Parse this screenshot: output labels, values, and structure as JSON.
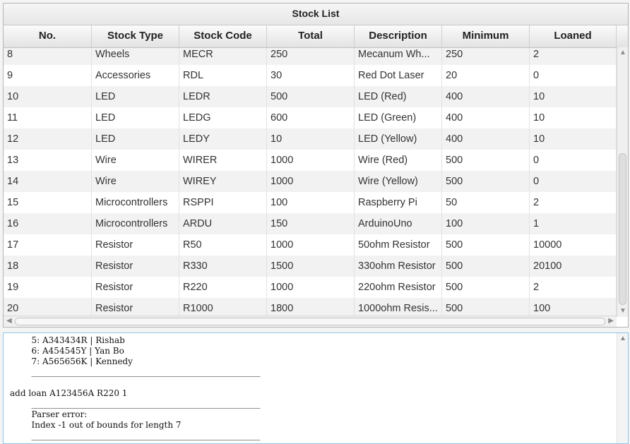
{
  "table": {
    "title": "Stock List",
    "columns": [
      "No.",
      "Stock Type",
      "Stock Code",
      "Total",
      "Description",
      "Minimum",
      "Loaned"
    ],
    "rows": [
      [
        "8",
        "Wheels",
        "MECR",
        "250",
        "Mecanum Wh...",
        "250",
        "2"
      ],
      [
        "9",
        "Accessories",
        "RDL",
        "30",
        "Red Dot Laser",
        "20",
        "0"
      ],
      [
        "10",
        "LED",
        "LEDR",
        "500",
        "LED (Red)",
        "400",
        "10"
      ],
      [
        "11",
        "LED",
        "LEDG",
        "600",
        "LED (Green)",
        "400",
        "10"
      ],
      [
        "12",
        "LED",
        "LEDY",
        "10",
        "LED (Yellow)",
        "400",
        "10"
      ],
      [
        "13",
        "Wire",
        "WIRER",
        "1000",
        "Wire (Red)",
        "500",
        "0"
      ],
      [
        "14",
        "Wire",
        "WIREY",
        "1000",
        "Wire (Yellow)",
        "500",
        "0"
      ],
      [
        "15",
        "Microcontrollers",
        "RSPPI",
        "100",
        "Raspberry Pi",
        "50",
        "2"
      ],
      [
        "16",
        "Microcontrollers",
        "ARDU",
        "150",
        "ArduinoUno",
        "100",
        "1"
      ],
      [
        "17",
        "Resistor",
        "R50",
        "1000",
        "50ohm Resistor",
        "500",
        "10000"
      ],
      [
        "18",
        "Resistor",
        "R330",
        "1500",
        "330ohm Resistor",
        "500",
        "20100"
      ],
      [
        "19",
        "Resistor",
        "R220",
        "1000",
        "220ohm Resistor",
        "500",
        "2"
      ],
      [
        "20",
        "Resistor",
        "R1000",
        "1800",
        "1000ohm Resis...",
        "500",
        "100"
      ]
    ]
  },
  "console": {
    "lines": [
      "        5: A343434R | Rishab",
      "        6: A454545Y | Yan Bo",
      "        7: A565656K | Kennedy",
      "        ______________________________________________________",
      "",
      "add loan A123456A R220 1",
      "        ______________________________________________________",
      "        Parser error:",
      "        Index -1 out of bounds for length 7",
      "        ______________________________________________________"
    ]
  },
  "icons": {
    "scroll_up": "chevron-up-icon",
    "scroll_down": "chevron-down-icon",
    "scroll_left": "chevron-left-icon",
    "scroll_right": "chevron-right-icon"
  },
  "colors": {
    "console_border": "#8fc6e8",
    "row_alt": "#f2f2f2"
  }
}
